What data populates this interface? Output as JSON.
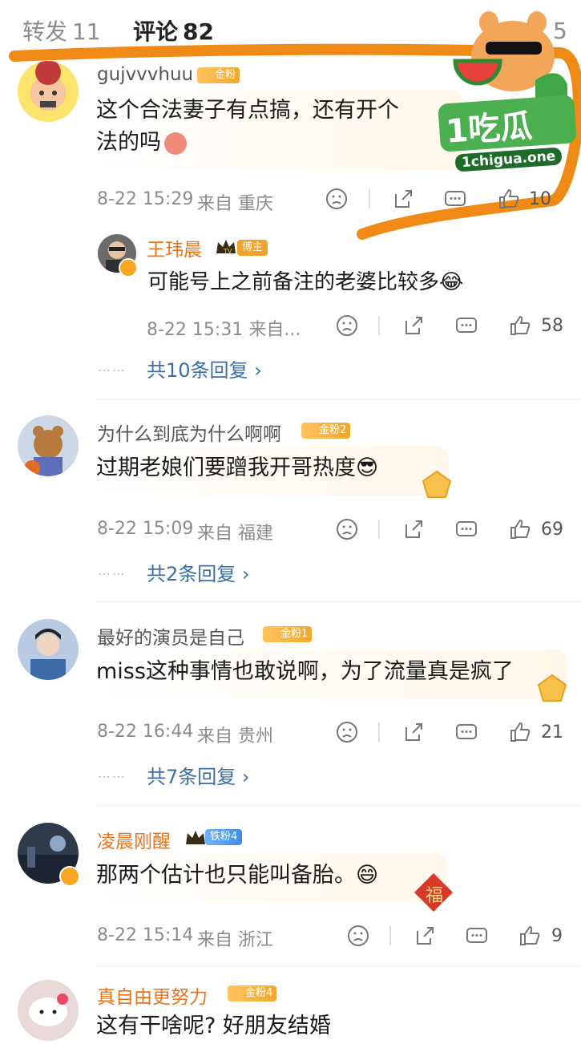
{
  "tabs": [
    {
      "label": "转发",
      "count": "11"
    },
    {
      "label": "评论",
      "count": "82"
    }
  ],
  "tab_right_fragment": "5",
  "watermark": {
    "brand": "1吃瓜",
    "url": "1chigua.one"
  },
  "comments": [
    {
      "user": "gujvvvhuu",
      "badge": "金粉",
      "text1": "这个合法妻子有点搞，还有开个",
      "text2": "法的吗",
      "time": "8-22 15:29",
      "location": "来自 重庆",
      "likes": "10"
    },
    {
      "user": "为什么到底为什么啊啊",
      "badge": "金粉2",
      "text1": "过期老娘们要蹭我开哥热度😎",
      "time": "8-22 15:09",
      "location": "来自 福建",
      "likes": "69",
      "replies": "共2条回复"
    },
    {
      "user": "最好的演员是自己",
      "badge": "金粉1",
      "text1": "miss这种事情也敢说啊，为了流量真是疯了",
      "time": "8-22 16:44",
      "location": "来自 贵州",
      "likes": "21",
      "replies": "共7条回复"
    },
    {
      "user": "凌晨刚醒",
      "badge": "铁粉4",
      "text1": "那两个估计也只能叫备胎。😄",
      "time": "8-22 15:14",
      "location": "来自 浙江",
      "likes": "9"
    },
    {
      "user": "真自由更努力",
      "badge": "金粉4",
      "text1": "这有干啥呢? 好朋友结婚"
    }
  ],
  "reply": {
    "user": "王玮晨",
    "role": "博主",
    "tv": "TV",
    "text": "可能号上之前备注的老婆比较多😂",
    "time": "8-22 15:31 来自...",
    "likes": "58",
    "total": "共10条回复"
  },
  "more_marker": "⋯⋯",
  "chevron": "›",
  "fu_char": "福",
  "icons": [
    "frown-icon",
    "share-icon",
    "comment-icon",
    "like-icon"
  ],
  "colors": {
    "accent_orange": "#f08a16",
    "link_blue": "#3a6ea5",
    "gray_text": "#8c8c8c"
  }
}
